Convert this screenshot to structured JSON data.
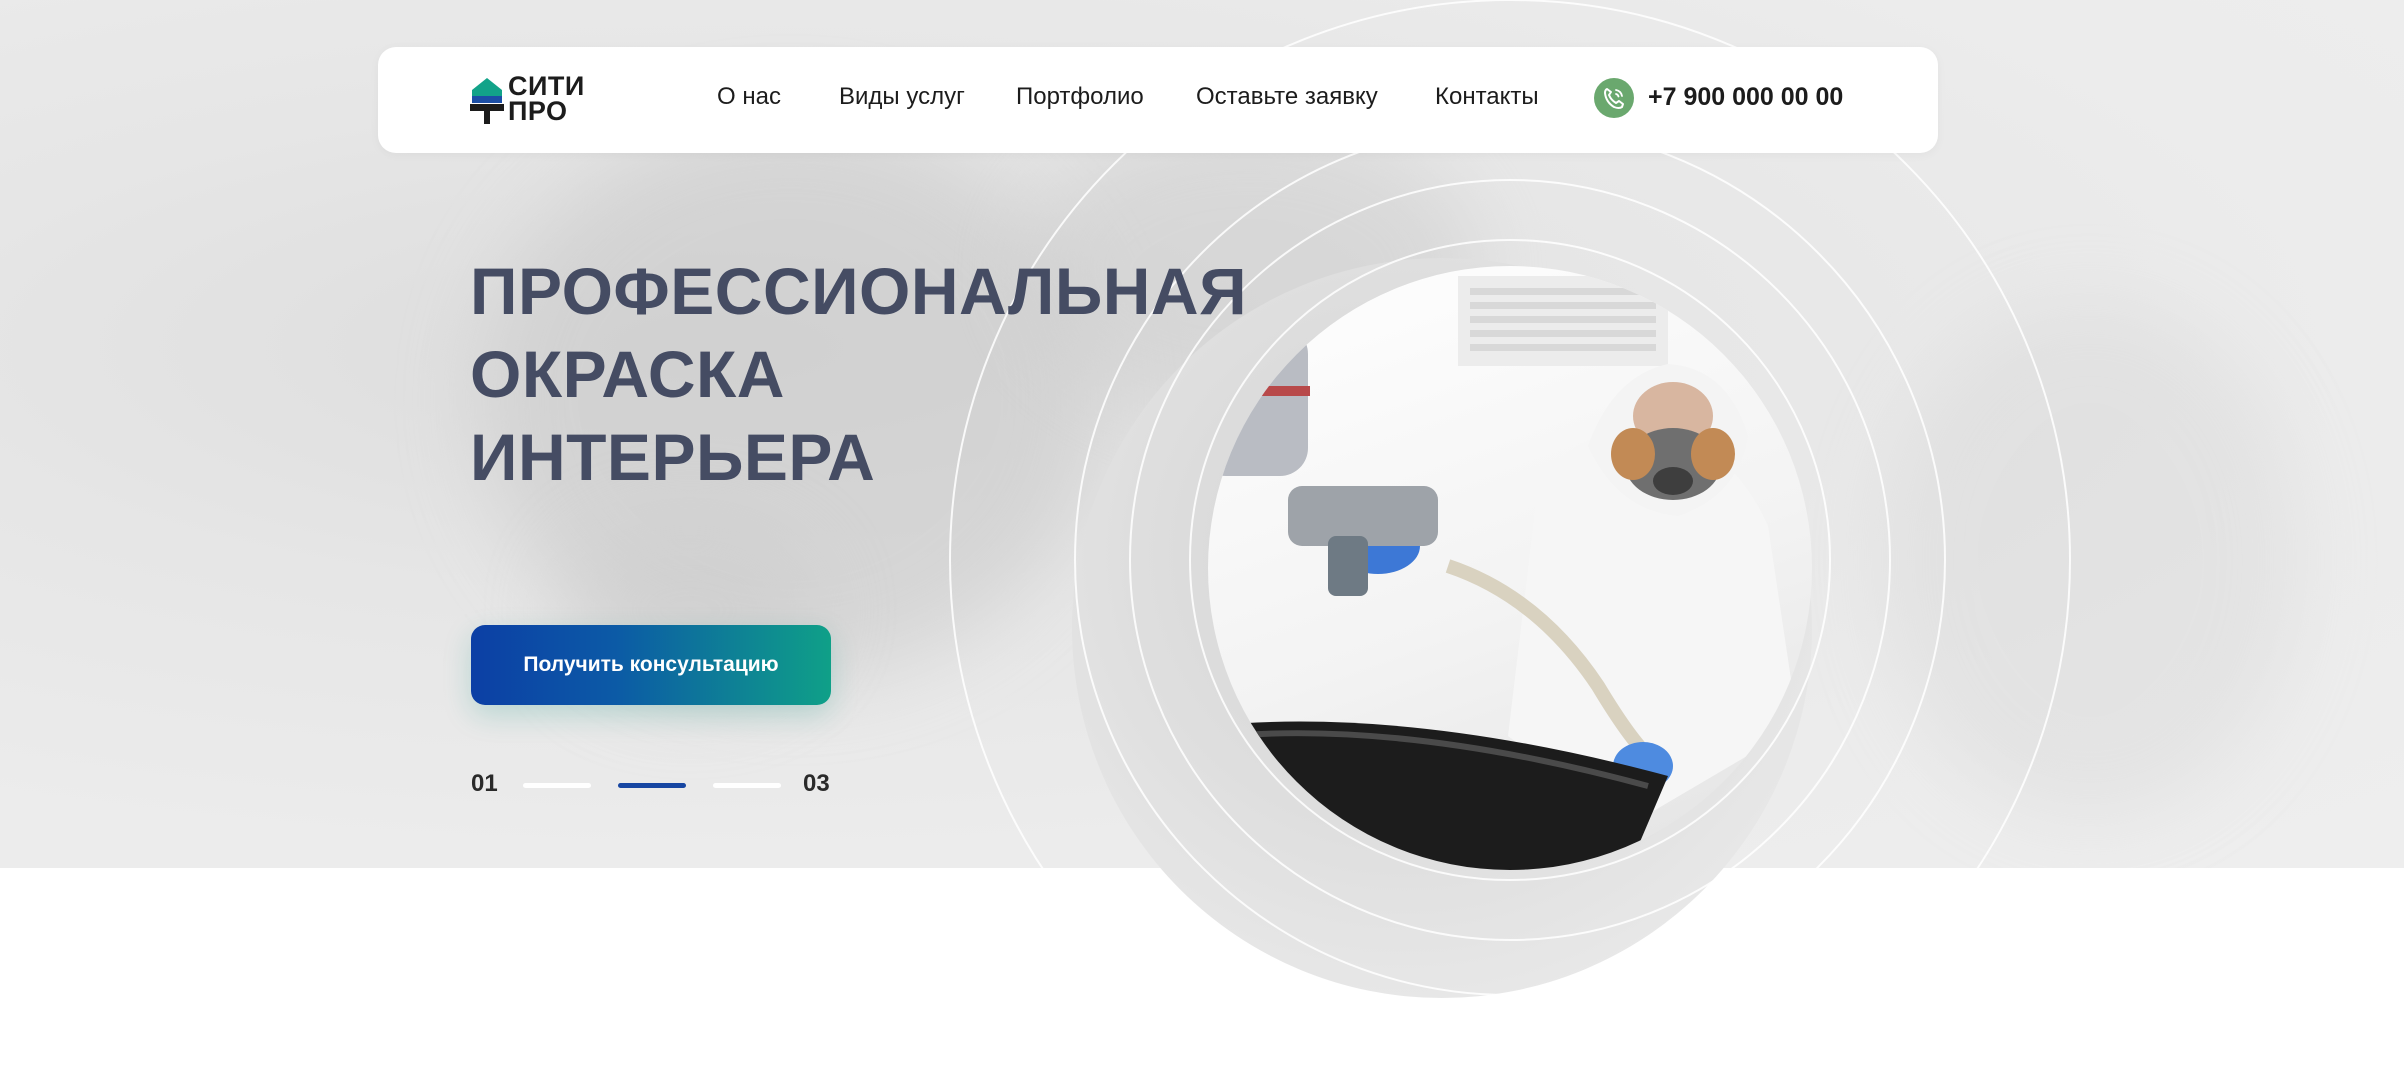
{
  "brand": {
    "logo_line1": "СИТИ",
    "logo_line2": "ПРО",
    "logo_colors": [
      "#12a389",
      "#1c4fa6",
      "#1c1c1c"
    ]
  },
  "nav": {
    "items": [
      {
        "label": "О нас"
      },
      {
        "label": "Виды услуг"
      },
      {
        "label": "Портфолио"
      },
      {
        "label": "Оставьте заявку"
      },
      {
        "label": "Контакты"
      }
    ]
  },
  "contact": {
    "phone": "+7 900 000 00 00",
    "phone_icon": "phone-icon",
    "icon_color": "#6aa86e"
  },
  "hero": {
    "title_lines": [
      "ПРОФЕССИОНАЛЬНАЯ",
      "ОКРАСКА",
      "ИНТЕРЬЕРА"
    ],
    "title_color": "#454c63",
    "cta_label": "Получить консультацию",
    "cta_gradient": [
      "#0c3fa5",
      "#0fa088"
    ],
    "image_subject": "painter-with-spray-gun"
  },
  "slider": {
    "start": "01",
    "end": "03",
    "total": 3,
    "active_index": 2,
    "active_color": "#1746a2"
  }
}
